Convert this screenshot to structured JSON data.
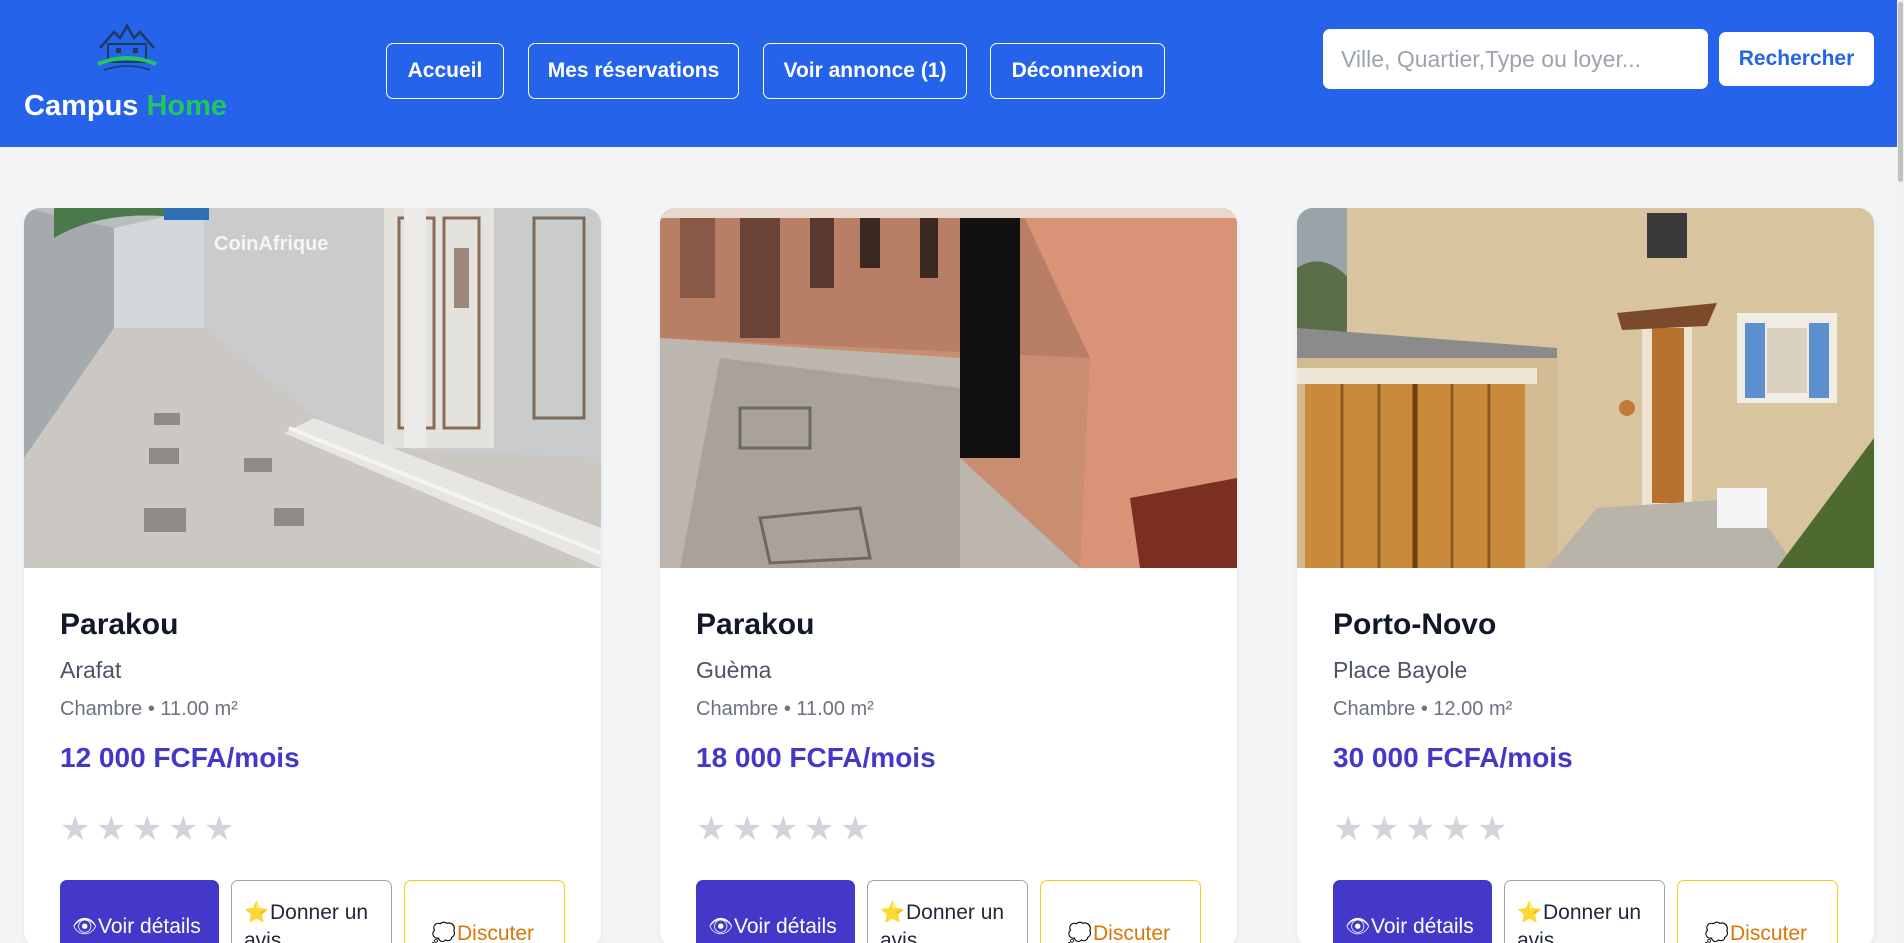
{
  "header": {
    "logo_text_1": "Campus",
    "logo_text_2": "Home",
    "nav": {
      "home": "Accueil",
      "reservations": "Mes réservations",
      "listings": "Voir annonce (1)",
      "logout": "Déconnexion"
    },
    "search": {
      "placeholder": "Ville, Quartier,Type ou loyer...",
      "value": "",
      "button": "Rechercher"
    }
  },
  "colors": {
    "header_bg": "#2563eb",
    "accent_green": "#22c55e",
    "price": "#4338ca",
    "primary_button": "#4338ca",
    "chat_border": "#facc15",
    "chat_text": "#d97706",
    "page_bg": "#f3f4f6"
  },
  "actions": {
    "details": "Voir détails",
    "review": "Donner un avis",
    "chat": "Discuter",
    "details_icon": "eye-icon",
    "review_icon": "star-icon",
    "chat_icon": "speech-bubble-icon"
  },
  "listings": [
    {
      "city": "Parakou",
      "district": "Arafat",
      "meta": "Chambre • 11.00 m²",
      "price": "12 000 FCFA/mois",
      "rating": 0,
      "image_watermark": "CoinAfrique"
    },
    {
      "city": "Parakou",
      "district": "Guèma",
      "meta": "Chambre • 11.00 m²",
      "price": "18 000 FCFA/mois",
      "rating": 0
    },
    {
      "city": "Porto-Novo",
      "district": "Place Bayole",
      "meta": "Chambre • 12.00 m²",
      "price": "30 000 FCFA/mois",
      "rating": 0
    }
  ]
}
